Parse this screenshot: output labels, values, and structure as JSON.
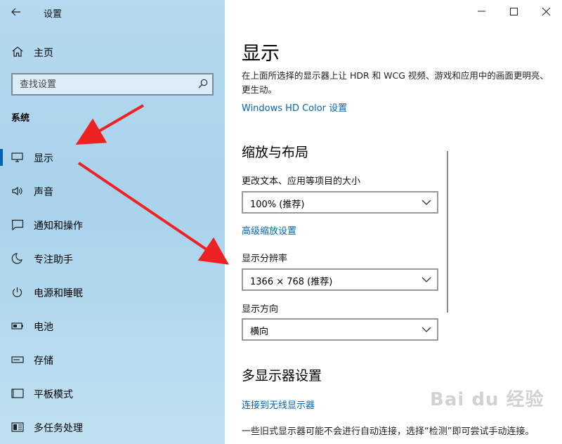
{
  "window": {
    "title": "设置"
  },
  "sidebar": {
    "home_label": "主页",
    "search_placeholder": "查找设置",
    "section_title": "系统",
    "items": [
      {
        "label": "显示",
        "icon": "monitor-icon",
        "selected": true
      },
      {
        "label": "声音",
        "icon": "speaker-icon"
      },
      {
        "label": "通知和操作",
        "icon": "notification-icon"
      },
      {
        "label": "专注助手",
        "icon": "moon-icon"
      },
      {
        "label": "电源和睡眠",
        "icon": "power-icon"
      },
      {
        "label": "电池",
        "icon": "battery-icon"
      },
      {
        "label": "存储",
        "icon": "storage-icon"
      },
      {
        "label": "平板模式",
        "icon": "tablet-icon"
      },
      {
        "label": "多任务处理",
        "icon": "multitask-icon"
      }
    ]
  },
  "main": {
    "title": "显示",
    "description": "在上面所选择的显示器上让 HDR 和 WCG 视频、游戏和应用中的画面更明亮、更生动。",
    "hdr_link": "Windows HD Color 设置",
    "scale_section_title": "缩放与布局",
    "scale_label": "更改文本、应用等项目的大小",
    "scale_value": "100% (推荐)",
    "advanced_scale_link": "高级缩放设置",
    "resolution_label": "显示分辨率",
    "resolution_value": "1366 × 768 (推荐)",
    "orientation_label": "显示方向",
    "orientation_value": "横向",
    "multi_display_title": "多显示器设置",
    "wireless_link": "连接到无线显示器",
    "multi_display_note": "一些旧式显示器可能不会进行自动连接，选择“检测”即可尝试手动连接。"
  },
  "watermark": "Bai du 经验",
  "colors": {
    "accent": "#0063b1",
    "link": "#0067b8",
    "annotation_arrow": "#ee2222"
  }
}
